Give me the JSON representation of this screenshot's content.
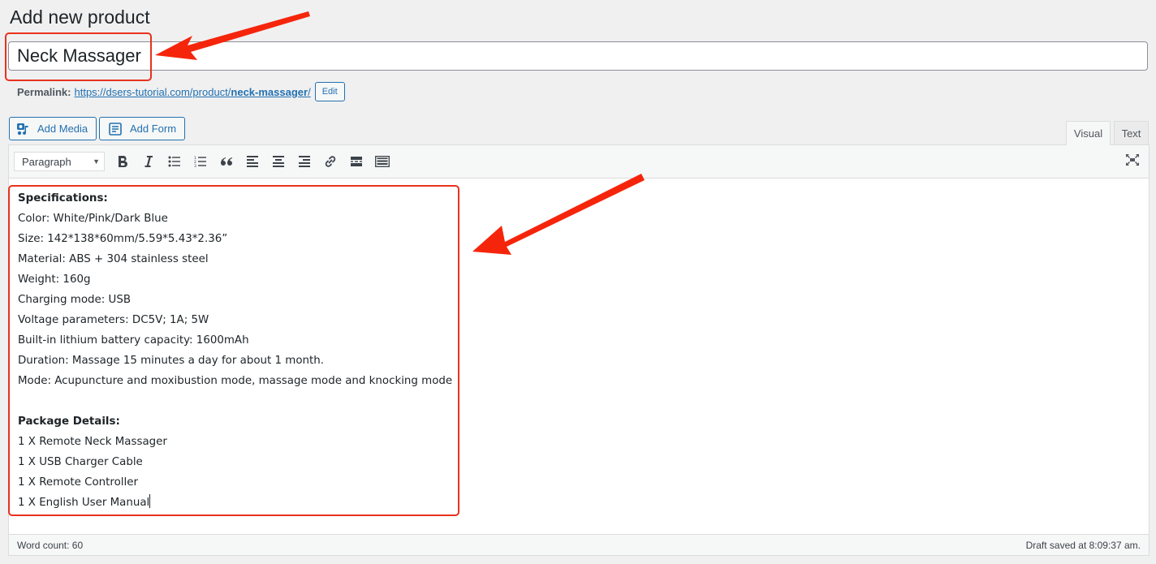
{
  "page": {
    "title": "Add new product"
  },
  "product": {
    "title_value": "Neck Massager",
    "permalink_label": "Permalink:",
    "permalink_base": "https://dsers-tutorial.com/product/",
    "permalink_slug": "neck-massager",
    "permalink_trailing": "/",
    "edit_label": "Edit"
  },
  "media_buttons": [
    {
      "label": "Add Media",
      "icon": "media-icon"
    },
    {
      "label": "Add Form",
      "icon": "form-icon"
    }
  ],
  "editor": {
    "tabs": [
      {
        "label": "Visual",
        "active": true
      },
      {
        "label": "Text",
        "active": false
      }
    ],
    "format_select": "Paragraph",
    "toolbar_icons": [
      "bold-icon",
      "italic-icon",
      "bullet-list-icon",
      "numbered-list-icon",
      "blockquote-icon",
      "align-left-icon",
      "align-center-icon",
      "align-right-icon",
      "link-icon",
      "read-more-icon",
      "toolbar-toggle-icon"
    ],
    "fullscreen_icon": "fullscreen-icon",
    "content": {
      "spec_heading": "Specifications:",
      "spec_lines": [
        "Color: White/Pink/Dark Blue",
        "Size: 142*138*60mm/5.59*5.43*2.36”",
        "Material: ABS + 304 stainless steel",
        "Weight: 160g",
        "Charging mode: USB",
        "Voltage parameters: DC5V; 1A; 5W",
        "Built-in lithium battery capacity: 1600mAh",
        "Duration: Massage 15 minutes a day for about 1 month.",
        "Mode: Acupuncture and moxibustion mode, massage mode and knocking mode"
      ],
      "package_heading": "Package Details:",
      "package_lines": [
        "1 X Remote Neck Massager",
        "1 X USB Charger Cable",
        "1 X Remote Controller",
        "1 X English User Manual"
      ]
    },
    "word_count": "Word count: 60",
    "draft_status": "Draft saved at 8:09:37 am."
  },
  "colors": {
    "accent": "#2271b1",
    "annotation": "#e8321e"
  }
}
